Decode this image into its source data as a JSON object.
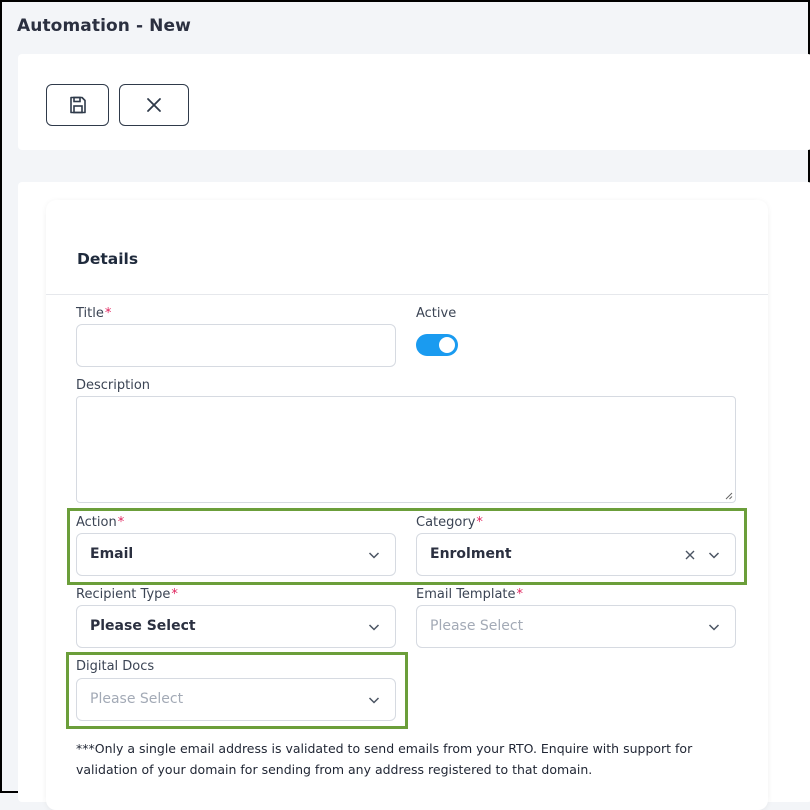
{
  "page": {
    "title": "Automation - New"
  },
  "toolbar": {
    "save_icon": "save-icon",
    "close_icon": "close-icon"
  },
  "details": {
    "section_title": "Details",
    "title": {
      "label": "Title",
      "value": ""
    },
    "active": {
      "label": "Active",
      "on": true
    },
    "description": {
      "label": "Description",
      "value": ""
    },
    "action": {
      "label": "Action",
      "value": "Email"
    },
    "category": {
      "label": "Category",
      "value": "Enrolment"
    },
    "recipient_type": {
      "label": "Recipient Type",
      "value": "Please Select"
    },
    "email_template": {
      "label": "Email Template",
      "placeholder": "Please Select"
    },
    "digital_docs": {
      "label": "Digital Docs",
      "placeholder": "Please Select"
    },
    "required_mark": "*",
    "note": "***Only a single email address is validated to send emails from your RTO. Enquire with support for validation of your domain for sending from any address registered to that domain."
  },
  "colors": {
    "accent": "#1a9bf0",
    "highlight": "#6b9e3a",
    "required": "#e0245e"
  }
}
